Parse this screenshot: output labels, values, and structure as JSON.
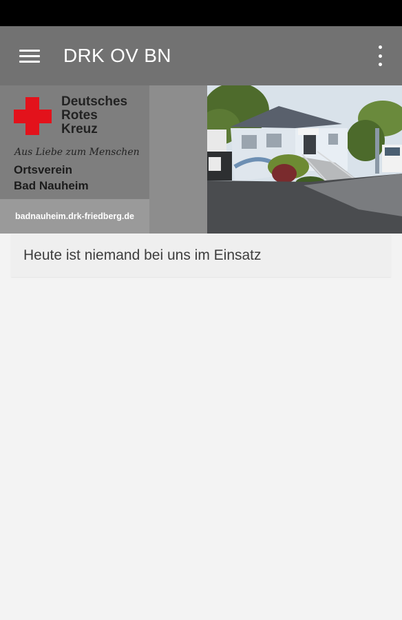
{
  "app_bar": {
    "title": "DRK OV BN",
    "menu_icon": "hamburger-menu-icon",
    "overflow_icon": "more-vertical-icon",
    "background": "#727272"
  },
  "banner": {
    "logo_lines": [
      "Deutsches",
      "Rotes",
      "Kreuz"
    ],
    "motto": "Aus Liebe zum Menschen",
    "local_lines": [
      "Ortsverein",
      "Bad Nauheim"
    ],
    "url": "badnauheim.drk-friedberg.de",
    "cross_color": "#e3121b"
  },
  "status": {
    "message": "Heute ist niemand bei uns im Einsatz"
  }
}
